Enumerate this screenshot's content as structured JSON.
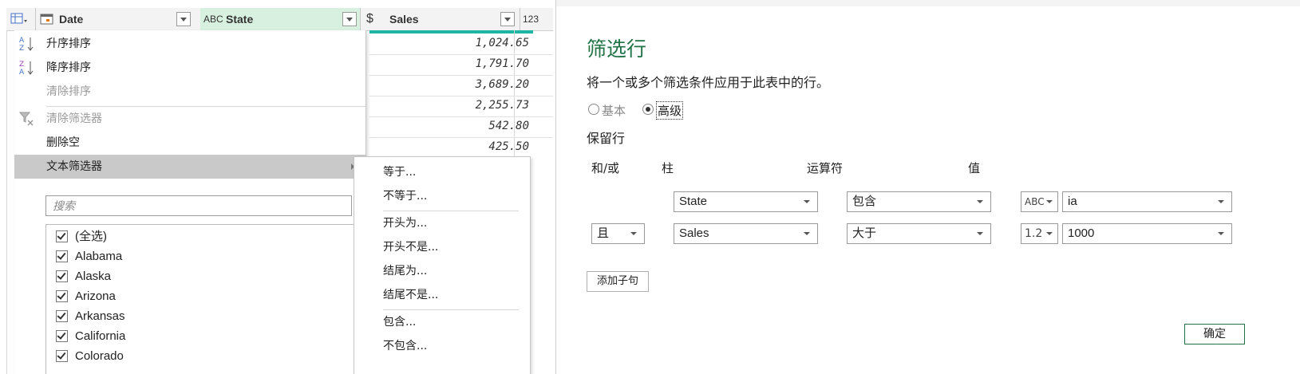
{
  "grid": {
    "columns": [
      {
        "type_icon": "table-icon",
        "label": ""
      },
      {
        "type_icon": "calendar-icon",
        "label": "Date"
      },
      {
        "type_icon": "text-type-icon",
        "type_glyph": "ABC",
        "label": "State"
      },
      {
        "type_icon": "currency-icon",
        "type_glyph": "$",
        "label": "Sales"
      },
      {
        "type_icon": "whole-number-icon",
        "type_glyph": "123",
        "label": ""
      }
    ],
    "sales_values": [
      "1,024.65",
      "1,791.70",
      "3,689.20",
      "2,255.73",
      "542.80",
      "425.50"
    ],
    "accent_color": "#1fb5a5"
  },
  "menu": {
    "items": [
      {
        "label": "升序排序",
        "icon": "sort-ascending-icon",
        "disabled": false
      },
      {
        "label": "降序排序",
        "icon": "sort-descending-icon",
        "disabled": false
      },
      {
        "label": "清除排序",
        "icon": "",
        "disabled": true
      },
      {
        "label": "清除筛选器",
        "icon": "clear-filter-icon",
        "disabled": true
      },
      {
        "label": "删除空",
        "icon": "",
        "disabled": false
      },
      {
        "label": "文本筛选器",
        "icon": "",
        "disabled": false,
        "highlighted": true
      }
    ],
    "search_placeholder": "搜索",
    "list": [
      "(全选)",
      "Alabama",
      "Alaska",
      "Arizona",
      "Arkansas",
      "California",
      "Colorado"
    ]
  },
  "submenu": {
    "items": [
      "等于...",
      "不等于...",
      "开头为...",
      "开头不是...",
      "结尾为...",
      "结尾不是...",
      "包含...",
      "不包含..."
    ]
  },
  "dialog": {
    "title": "筛选行",
    "description": "将一个或多个筛选条件应用于此表中的行。",
    "mode_basic": "基本",
    "mode_advanced": "高级",
    "selected_mode": "高级",
    "keep_rows": "保留行",
    "headers": {
      "andor": "和/或",
      "column": "柱",
      "operator": "运算符",
      "value": "值"
    },
    "rows": [
      {
        "andor": "",
        "column": "State",
        "operator": "包含",
        "type": "ABC",
        "value": "ia"
      },
      {
        "andor": "且",
        "column": "Sales",
        "operator": "大于",
        "type": "1.2",
        "value": "1000"
      }
    ],
    "add_clause": "添加子句",
    "ok": "确定",
    "title_color": "#217346"
  }
}
